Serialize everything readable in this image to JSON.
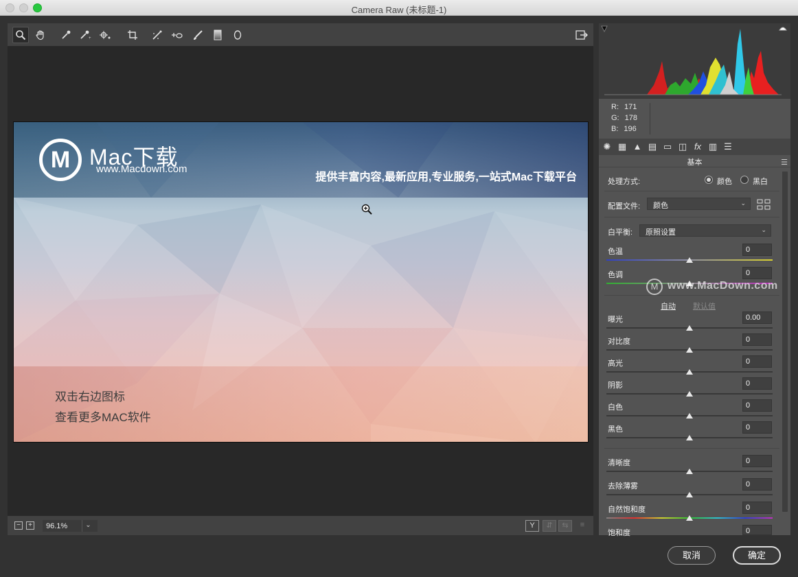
{
  "window": {
    "title": "Camera Raw (未标题-1)"
  },
  "toolbar": {
    "tools": [
      "zoom-tool",
      "hand-tool",
      "white-balance-tool",
      "color-sampler-tool",
      "targeted-adjustment-tool",
      "crop-tool",
      "straighten-tool",
      "spot-removal-tool",
      "adjustment-brush-tool",
      "graduated-filter-tool",
      "radial-filter-tool"
    ],
    "open_prefs": "preferences-icon"
  },
  "photo": {
    "logo_letter": "M",
    "logo_text": "Mac下载",
    "logo_url": "www.Macdown.com",
    "slogan": "提供丰富内容,最新应用,专业服务,一站式Mac下载平台",
    "line1": "双击右边图标",
    "line2": "查看更多MAC软件"
  },
  "statusbar": {
    "zoom_out": "−",
    "zoom_in": "+",
    "zoom_level": "96.1%",
    "view_buttons": [
      "Y",
      "⇵",
      "⇆",
      "≡"
    ]
  },
  "readout": {
    "r_label": "R:",
    "r": "171",
    "g_label": "G:",
    "g": "178",
    "b_label": "B:",
    "b": "196"
  },
  "panel": {
    "title": "基本",
    "treatment_label": "处理方式:",
    "treatment_color": "颜色",
    "treatment_bw": "黑白",
    "profile_label": "配置文件:",
    "profile_value": "颜色",
    "wb_label": "白平衡:",
    "wb_value": "原照设置",
    "auto": "自动",
    "default": "默认值",
    "sliders": [
      {
        "label": "色温",
        "value": "0"
      },
      {
        "label": "色调",
        "value": "0"
      },
      {
        "label": "曝光",
        "value": "0.00"
      },
      {
        "label": "对比度",
        "value": "0"
      },
      {
        "label": "高光",
        "value": "0"
      },
      {
        "label": "阴影",
        "value": "0"
      },
      {
        "label": "白色",
        "value": "0"
      },
      {
        "label": "黑色",
        "value": "0"
      },
      {
        "label": "清晰度",
        "value": "0"
      },
      {
        "label": "去除薄雾",
        "value": "0"
      },
      {
        "label": "自然饱和度",
        "value": "0"
      },
      {
        "label": "饱和度",
        "value": "0"
      }
    ]
  },
  "watermark": {
    "letter": "M",
    "text": "www.MacDown.com"
  },
  "buttons": {
    "cancel": "取消",
    "ok": "确定"
  }
}
